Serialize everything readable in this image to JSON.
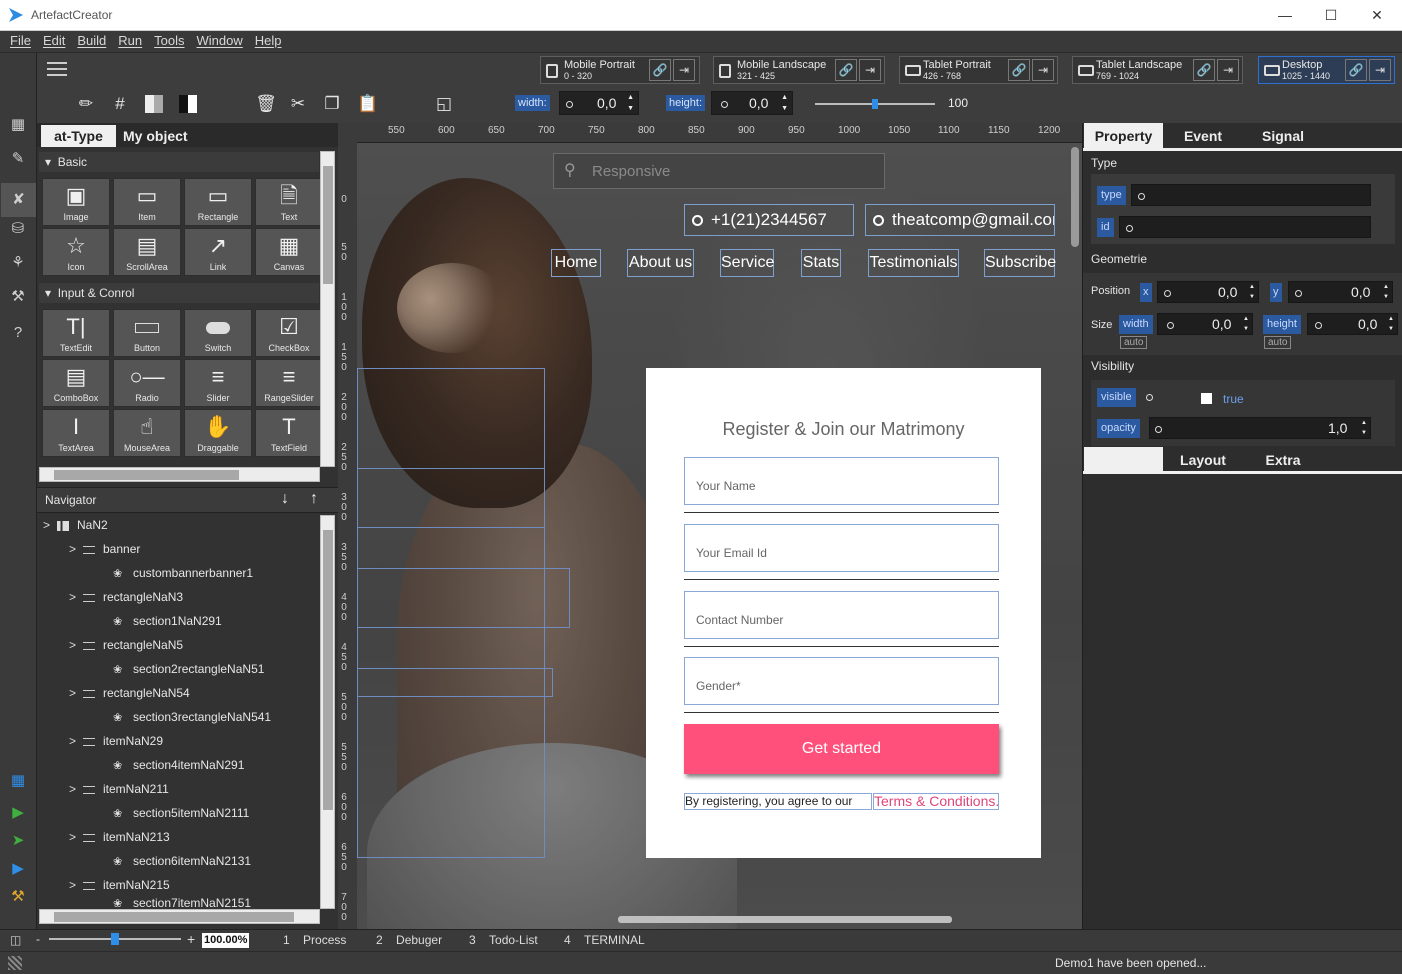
{
  "app": {
    "title": "ArtefactCreator"
  },
  "menu": [
    "File",
    "Edit",
    "Build",
    "Run",
    "Tools",
    "Window",
    "Help"
  ],
  "devices": [
    {
      "name": "Mobile Portrait",
      "range": "0 - 320"
    },
    {
      "name": "Mobile Landscape",
      "range": "321 - 425"
    },
    {
      "name": "Tablet Portrait",
      "range": "426 - 768"
    },
    {
      "name": "Tablet Landscape",
      "range": "769 - 1024"
    },
    {
      "name": "Desktop",
      "range": "1025 - 1440"
    }
  ],
  "toolbar": {
    "width_label": "width:",
    "width_value": "0,0",
    "height_label": "height:",
    "height_value": "0,0",
    "zoom_value": "100",
    "zoom_fraction": 0.5
  },
  "left_panel": {
    "tabs": [
      "at-Type",
      "My object"
    ],
    "basic_header": "Basic",
    "basic_items": [
      "Image",
      "Item",
      "Rectangle",
      "Text",
      "Icon",
      "ScrollArea",
      "Link",
      "Canvas"
    ],
    "input_header": "Input & Conrol",
    "input_items": [
      "TextEdit",
      "Button",
      "Switch",
      "CheckBox",
      "ComboBox",
      "Radio",
      "Slider",
      "RangeSlider",
      "TextArea",
      "MouseArea",
      "Draggable",
      "TextField"
    ]
  },
  "navigator": {
    "title": "Navigator",
    "rows": [
      {
        "label": "NaN2"
      },
      {
        "label": "banner"
      },
      {
        "label": "custombannerbanner1"
      },
      {
        "label": "rectangleNaN3"
      },
      {
        "label": "section1NaN291"
      },
      {
        "label": "rectangleNaN5"
      },
      {
        "label": "section2rectangleNaN51"
      },
      {
        "label": "rectangleNaN54"
      },
      {
        "label": "section3rectangleNaN541"
      },
      {
        "label": "itemNaN29"
      },
      {
        "label": "section4itemNaN291"
      },
      {
        "label": "itemNaN211"
      },
      {
        "label": "section5itemNaN2111"
      },
      {
        "label": "itemNaN213"
      },
      {
        "label": "section6itemNaN2131"
      },
      {
        "label": "itemNaN215"
      },
      {
        "label": "section7itemNaN2151"
      }
    ]
  },
  "ruler": {
    "h": [
      "550",
      "600",
      "650",
      "700",
      "750",
      "800",
      "850",
      "900",
      "950",
      "1000",
      "1050",
      "1100",
      "1150",
      "1200"
    ],
    "v": [
      "0",
      "50",
      "100",
      "150",
      "200",
      "250",
      "300",
      "350",
      "400",
      "450",
      "500",
      "550",
      "600",
      "650",
      "700"
    ]
  },
  "canvas": {
    "search_placeholder": "Responsive",
    "phone": "+1(21)2344567",
    "email": "theatcomp@gmail.com",
    "nav": [
      "Home",
      "About us",
      "Service",
      "Stats",
      "Testimonials",
      "Subscribe"
    ],
    "form": {
      "title": "Register & Join our Matrimony",
      "fields": [
        "Your Name",
        "Your Email Id",
        "Contact Number",
        "Gender*"
      ],
      "button": "Get started",
      "terms_prefix": "By registering, you agree to our",
      "terms_link": "Terms & Conditions."
    }
  },
  "right_panel": {
    "tabs": [
      "Property",
      "Event",
      "Signal"
    ],
    "type_section": "Type",
    "type_label": "type",
    "id_label": "id",
    "geom_section": "Geometrie",
    "position_label": "Position",
    "x_label": "x",
    "x_value": "0,0",
    "y_label": "y",
    "y_value": "0,0",
    "size_label": "Size",
    "width_label": "width",
    "width_value": "0,0",
    "height_label": "height",
    "height_value": "0,0",
    "auto": "auto",
    "visibility_section": "Visibility",
    "visible_label": "visible",
    "visible_value": "true",
    "opacity_label": "opacity",
    "opacity_value": "1,0",
    "bottom_tabs": [
      "Layout",
      "Extra"
    ]
  },
  "bottom": {
    "zoom": "100.00%",
    "tabs": [
      {
        "num": "1",
        "label": "Process"
      },
      {
        "num": "2",
        "label": "Debuger"
      },
      {
        "num": "3",
        "label": "Todo-List"
      },
      {
        "num": "4",
        "label": "TERMINAL"
      }
    ],
    "status": "Demo1 have been opened..."
  },
  "colors": {
    "accent": "#2b5aa0",
    "cta": "#ff4f7b",
    "link": "#e0457a"
  }
}
